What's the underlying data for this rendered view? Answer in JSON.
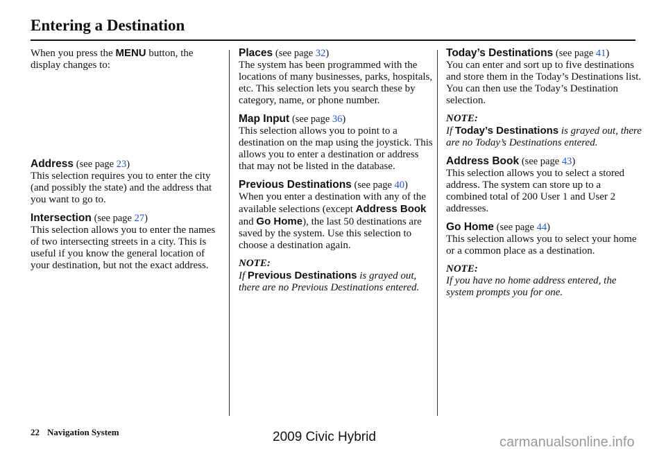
{
  "page": {
    "title": "Entering a Destination",
    "footer": {
      "page_number": "22",
      "section": "Navigation System",
      "model": "2009 Civic Hybrid",
      "watermark": "carmanualsonline.info"
    }
  },
  "intro": {
    "pre": "When you press the ",
    "button": "MENU",
    "post": " button, the display changes to:"
  },
  "see_page_prefix": "(see page ",
  "see_page_suffix": ")",
  "sections": {
    "address": {
      "heading": "Address",
      "page": "23",
      "body": "This selection requires you to enter the city (and possibly the state) and the address that you want to go to."
    },
    "intersection": {
      "heading": "Intersection",
      "page": "27",
      "body": "This selection allows you to enter the names of two intersecting streets in a city. This is useful if you know the general location of your destination, but not the exact address."
    },
    "places": {
      "heading": "Places",
      "page": "32",
      "body": "The system has been programmed with the locations of many businesses, parks, hospitals, etc. This selection lets you search these by category, name, or phone number."
    },
    "map_input": {
      "heading": "Map Input",
      "page": "36",
      "body": "This selection allows you to point to a destination on the map using the joystick. This allows you to enter a destination or address that may not be listed in the database."
    },
    "previous": {
      "heading": "Previous Destinations",
      "page": "40",
      "body_1": "When you enter a destination with any of the available selections (except ",
      "term_1": "Address Book",
      "and": " and ",
      "term_2": "Go Home",
      "body_2": "), the last 50 destinations are saved by the system. Use this selection to choose a destination again.",
      "note_label": "NOTE:",
      "note_if": "If ",
      "note_term": "Previous Destinations",
      "note_rest": " is grayed out, there are no Previous Destinations entered."
    },
    "todays": {
      "heading": "Today’s Destinations",
      "page": "41",
      "body": "You can enter and sort up to five destinations and store them in the Today’s Destinations list. You can then use the Today’s Destination selection.",
      "note_label": "NOTE:",
      "note_if": "If ",
      "note_term": "Today’s Destinations",
      "note_rest": " is grayed out, there are no Today’s Destinations entered."
    },
    "address_book": {
      "heading": "Address Book",
      "page": "43",
      "body": "This selection allows you to select a stored address. The system can store up to a combined total of  200 User 1 and User 2 addresses."
    },
    "go_home": {
      "heading": "Go Home",
      "page": "44",
      "body": "This selection allows you to select your home or a common place as a destination.",
      "note_label": "NOTE:",
      "note_text": "If you have no home address entered, the system prompts you for one."
    }
  }
}
